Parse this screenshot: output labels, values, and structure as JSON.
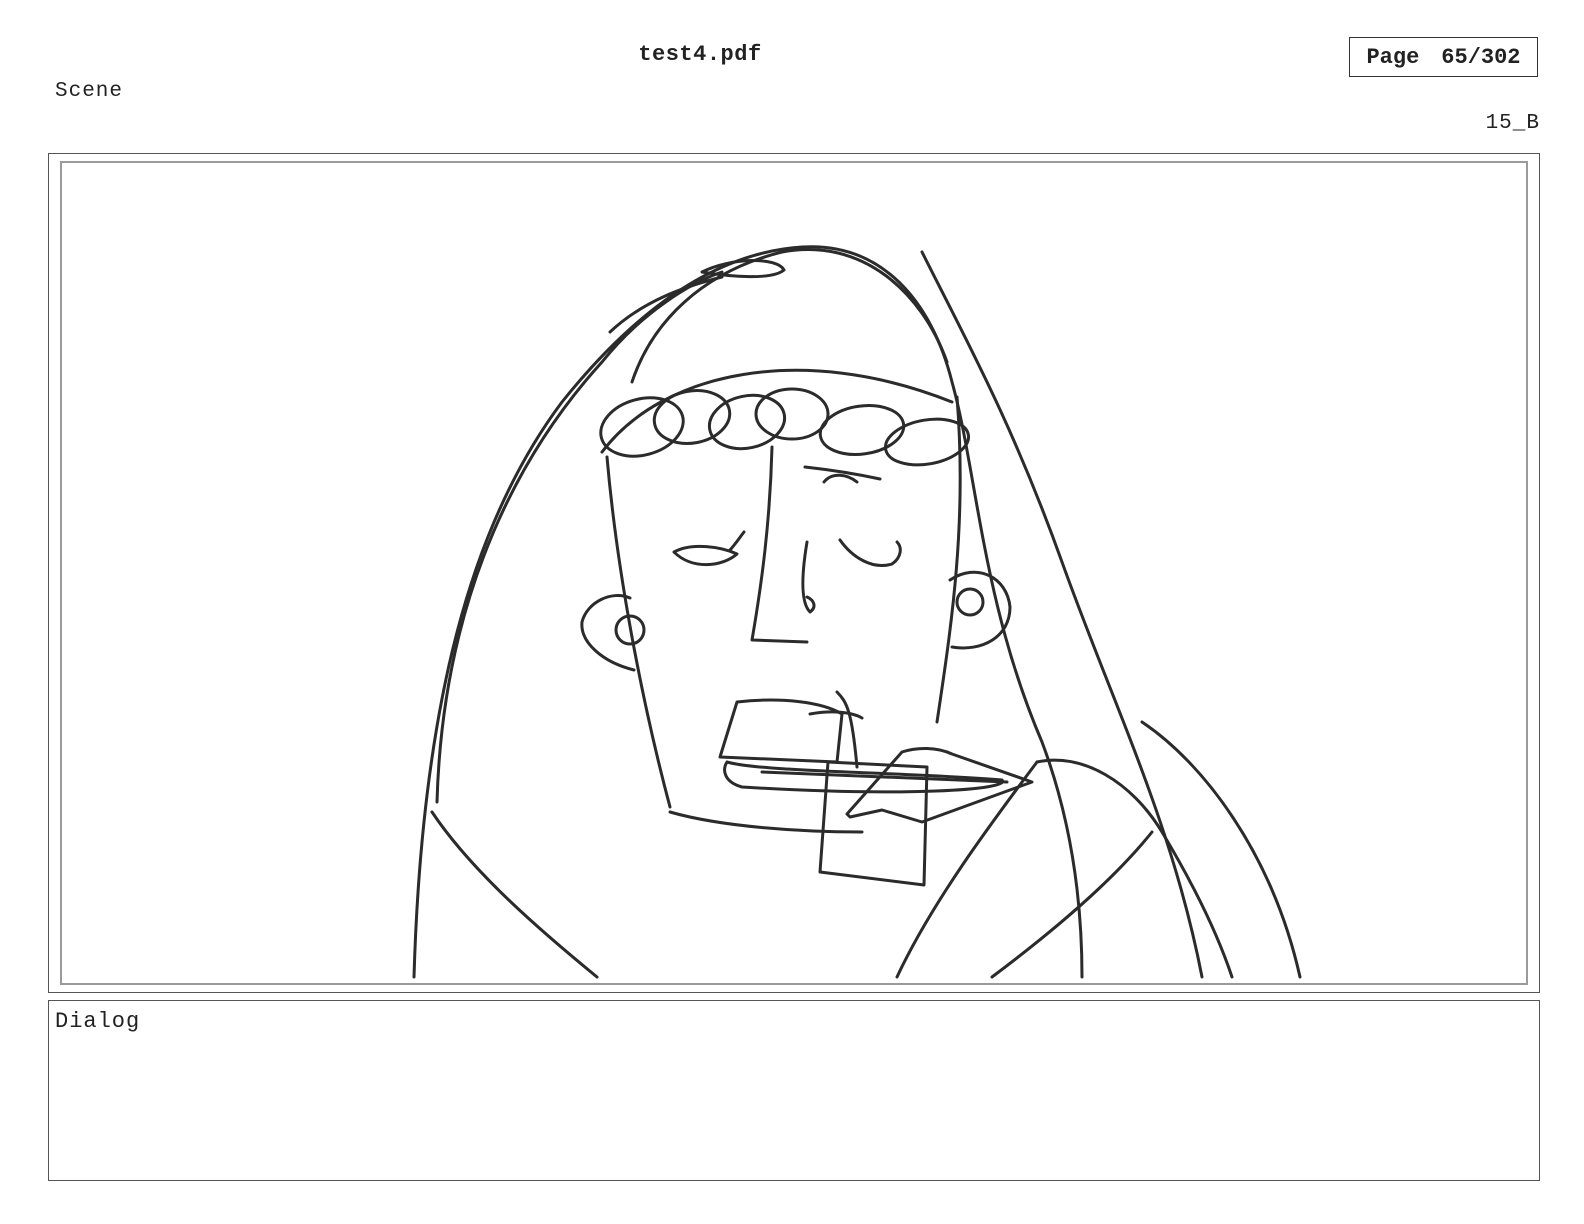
{
  "document": {
    "title": "test4.pdf"
  },
  "page": {
    "label": "Page",
    "number": "65/302"
  },
  "scene": {
    "label": "Scene",
    "shot_id": "15_B"
  },
  "panel": {
    "image": "storyboard-sketch-character-portrait"
  },
  "dialog": {
    "label": "Dialog",
    "text": ""
  }
}
